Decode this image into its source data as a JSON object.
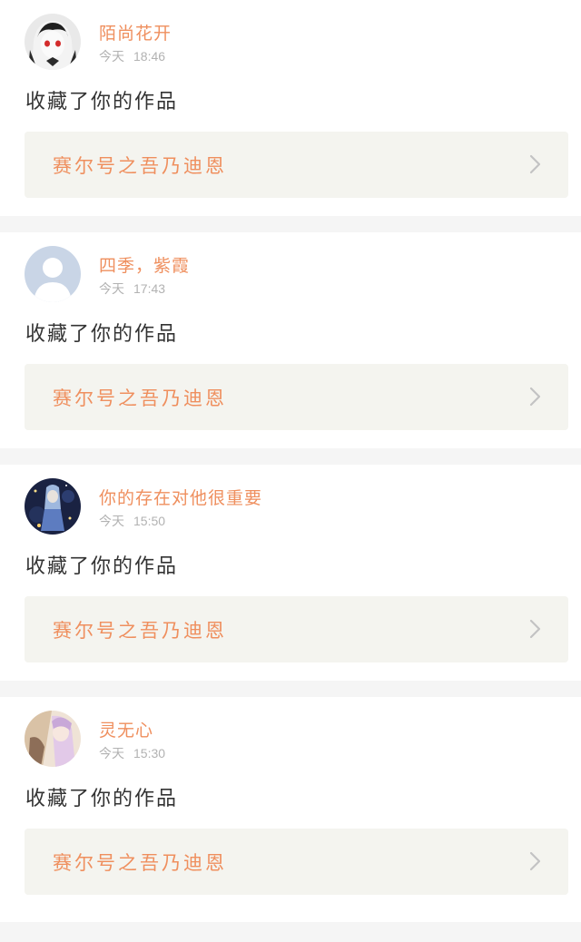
{
  "notifications": [
    {
      "username": "陌尚花开",
      "day": "今天",
      "time": "18:46",
      "action": "收藏了你的作品",
      "work_title": "赛尔号之吾乃迪恩",
      "avatar_icon": "anime-girl-avatar-icon"
    },
    {
      "username": "四季，紫霞",
      "day": "今天",
      "time": "17:43",
      "action": "收藏了你的作品",
      "work_title": "赛尔号之吾乃迪恩",
      "avatar_icon": "default-user-avatar-icon"
    },
    {
      "username": "你的存在对他很重要",
      "day": "今天",
      "time": "15:50",
      "action": "收藏了你的作品",
      "work_title": "赛尔号之吾乃迪恩",
      "avatar_icon": "starry-anime-avatar-icon"
    },
    {
      "username": "灵无心",
      "day": "今天",
      "time": "15:30",
      "action": "收藏了你的作品",
      "work_title": "赛尔号之吾乃迪恩",
      "avatar_icon": "pastel-anime-avatar-icon"
    }
  ],
  "colors": {
    "accent": "#ef8f5e",
    "action_text": "#333333",
    "muted": "#b2b2b2",
    "work_bg": "#f4f4ef",
    "divider": "#f5f5f5"
  }
}
